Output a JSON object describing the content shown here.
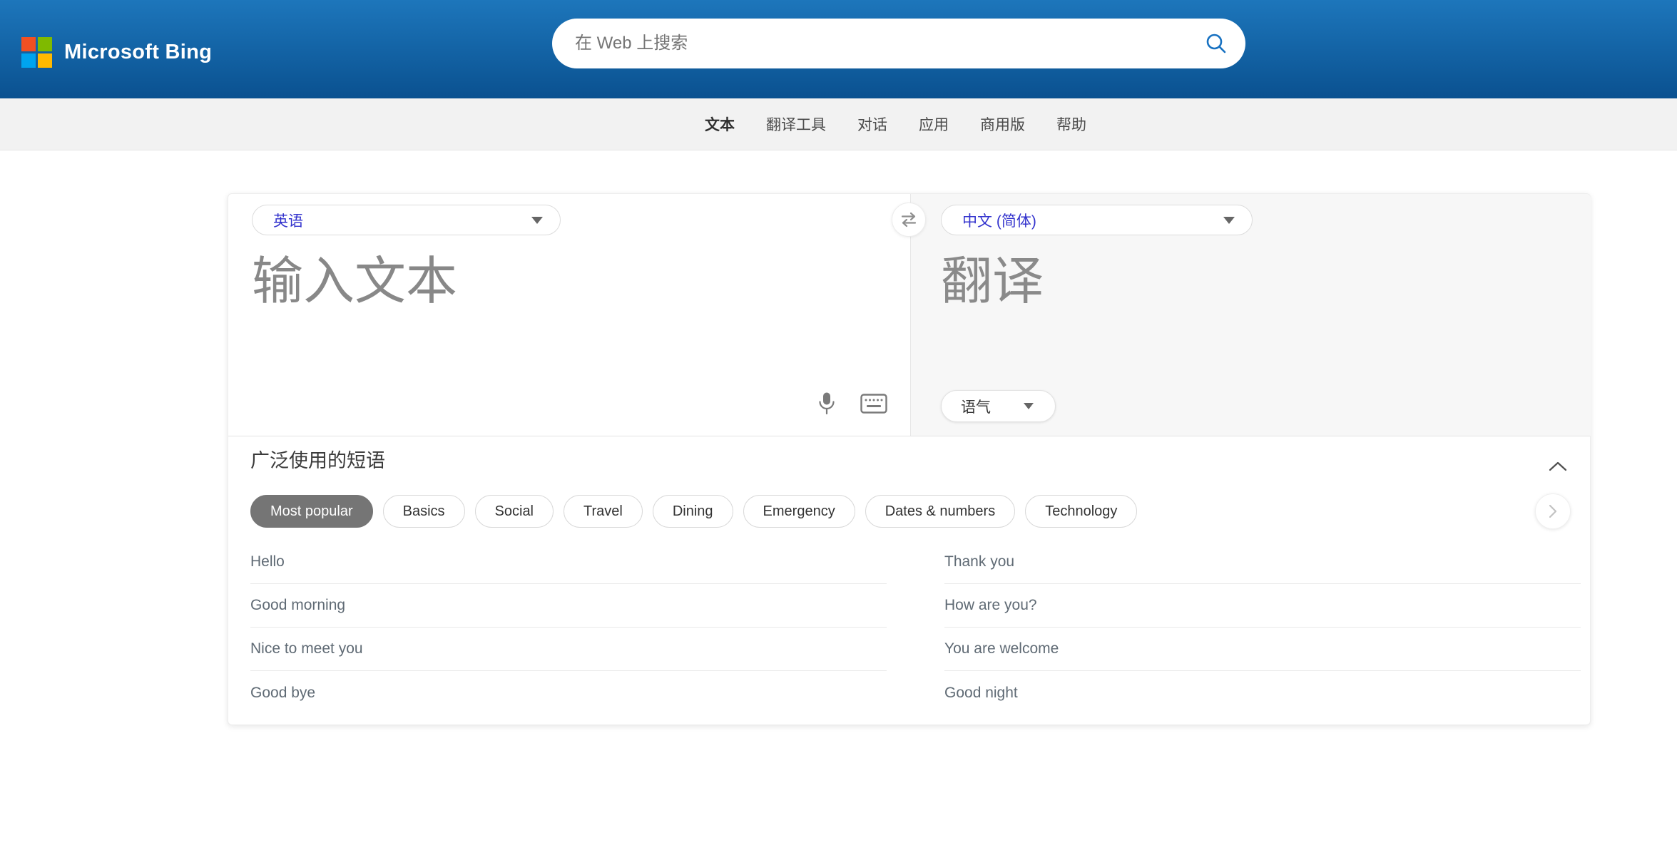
{
  "header": {
    "brand": "Microsoft Bing",
    "search_placeholder": "在 Web 上搜索"
  },
  "nav": {
    "tabs": [
      {
        "label": "文本",
        "active": true
      },
      {
        "label": "翻译工具",
        "active": false
      },
      {
        "label": "对话",
        "active": false
      },
      {
        "label": "应用",
        "active": false
      },
      {
        "label": "商用版",
        "active": false
      },
      {
        "label": "帮助",
        "active": false
      }
    ]
  },
  "translator": {
    "source_language": "英语",
    "target_language": "中文 (简体)",
    "source_placeholder": "输入文本",
    "target_placeholder": "翻译",
    "tone_label": "语气"
  },
  "phrases": {
    "title": "广泛使用的短语",
    "categories": [
      {
        "label": "Most popular",
        "selected": true
      },
      {
        "label": "Basics",
        "selected": false
      },
      {
        "label": "Social",
        "selected": false
      },
      {
        "label": "Travel",
        "selected": false
      },
      {
        "label": "Dining",
        "selected": false
      },
      {
        "label": "Emergency",
        "selected": false
      },
      {
        "label": "Dates & numbers",
        "selected": false
      },
      {
        "label": "Technology",
        "selected": false
      }
    ],
    "left_column": [
      "Hello",
      "Good morning",
      "Nice to meet you",
      "Good bye"
    ],
    "right_column": [
      "Thank you",
      "How are you?",
      "You are welcome",
      "Good night"
    ]
  },
  "icons": {
    "search": "magnifier",
    "microphone": "mic",
    "keyboard": "keyboard",
    "swap": "swap-horizontal-arrows",
    "collapse": "chevron-up",
    "next": "chevron-right",
    "dropdown": "caret-down"
  },
  "colors": {
    "header_gradient_top": "#1d76bb",
    "header_gradient_bottom": "#0a5190",
    "accent_language_text": "#3232cd",
    "nav_background": "#f2f2f2",
    "target_panel_background": "#f7f7f7",
    "selected_chip_background": "#757575",
    "logo_red": "#f25022",
    "logo_green": "#7fba00",
    "logo_blue": "#00a4ef",
    "logo_yellow": "#ffb900"
  }
}
